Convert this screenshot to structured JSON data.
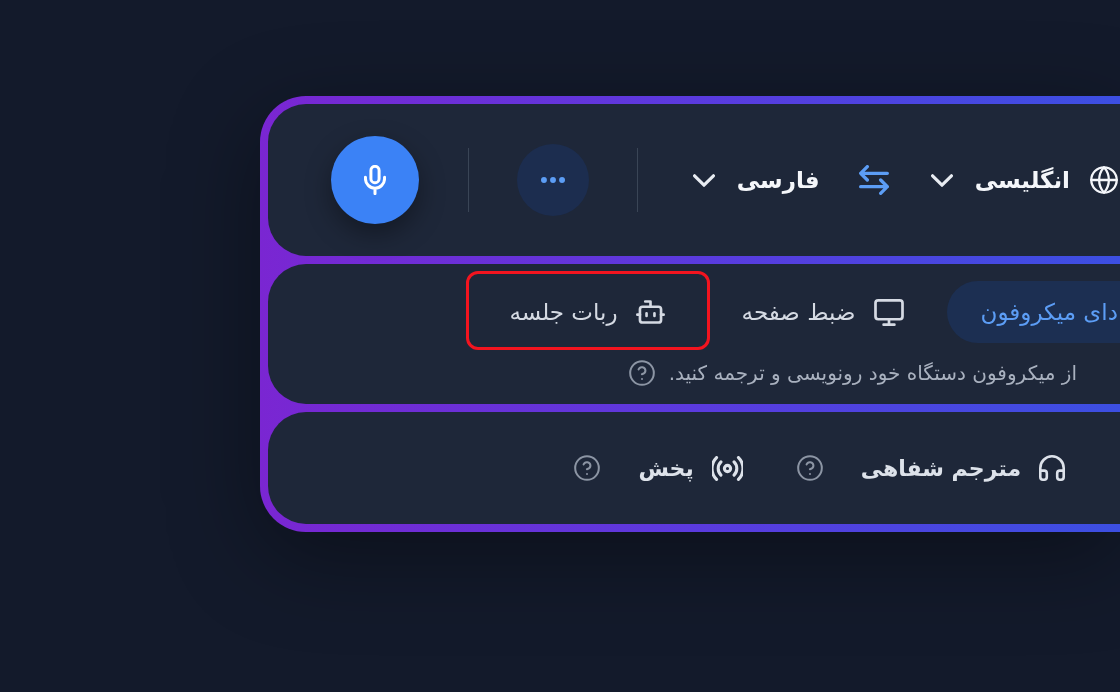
{
  "language_bar": {
    "source_language": "انگلیسی",
    "target_language": "فارسی"
  },
  "modes": [
    {
      "label": "دای میکروفون",
      "selected": true,
      "highlighted": false
    },
    {
      "label": "ضبط صفحه",
      "kind": "screen",
      "selected": false,
      "highlighted": false
    },
    {
      "label": "ربات جلسه",
      "kind": "bot",
      "selected": false,
      "highlighted": true
    }
  ],
  "mode_hint": "از میکروفون دستگاه خود رونویسی و ترجمه کنید.",
  "services": [
    {
      "label": "مترجم شفاهی",
      "kind": "headphones"
    },
    {
      "label": "پخش",
      "kind": "broadcast"
    }
  ]
}
